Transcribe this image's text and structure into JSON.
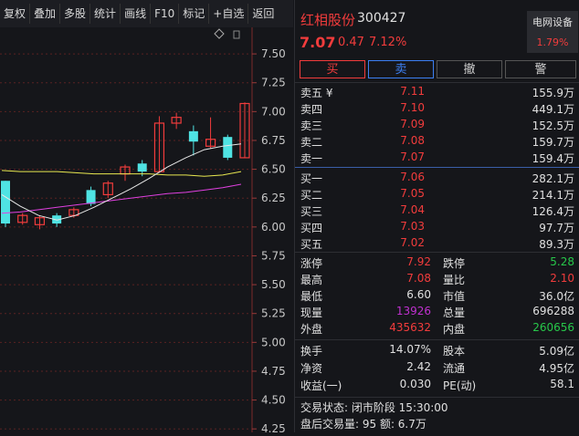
{
  "toolbar": [
    "复权",
    "叠加",
    "多股",
    "统计",
    "画线",
    "F10",
    "标记",
    "+自选",
    "返回"
  ],
  "stock": {
    "name": "红相股份",
    "code": "300427",
    "price": "7.07",
    "change": "0.47",
    "pct": "7.12%",
    "sector": "电网设备",
    "sector_pct": "1.79%"
  },
  "actions": [
    "买",
    "卖",
    "撤",
    "警"
  ],
  "asks": [
    {
      "label": "卖五 ¥",
      "price": "7.11",
      "vol": "155.9万"
    },
    {
      "label": "卖四",
      "price": "7.10",
      "vol": "449.1万"
    },
    {
      "label": "卖三",
      "price": "7.09",
      "vol": "152.5万"
    },
    {
      "label": "卖二",
      "price": "7.08",
      "vol": "159.7万"
    },
    {
      "label": "卖一",
      "price": "7.07",
      "vol": "159.4万"
    }
  ],
  "bids": [
    {
      "label": "买一",
      "price": "7.06",
      "vol": "282.1万"
    },
    {
      "label": "买二",
      "price": "7.05",
      "vol": "214.1万"
    },
    {
      "label": "买三",
      "price": "7.04",
      "vol": "126.4万"
    },
    {
      "label": "买四",
      "price": "7.03",
      "vol": "97.7万"
    },
    {
      "label": "买五",
      "price": "7.02",
      "vol": "89.3万"
    }
  ],
  "stats1": [
    {
      "l1": "涨停",
      "v1": "7.92",
      "c1": "red",
      "l2": "跌停",
      "v2": "5.28",
      "c2": "green"
    },
    {
      "l1": "最高",
      "v1": "7.08",
      "c1": "red",
      "l2": "量比",
      "v2": "2.10",
      "c2": "red"
    },
    {
      "l1": "最低",
      "v1": "6.60",
      "c1": "white",
      "l2": "市值",
      "v2": "36.0亿",
      "c2": "white"
    },
    {
      "l1": "现量",
      "v1": "13926",
      "c1": "purple",
      "l2": "总量",
      "v2": "696288",
      "c2": "white"
    },
    {
      "l1": "外盘",
      "v1": "435632",
      "c1": "red",
      "l2": "内盘",
      "v2": "260656",
      "c2": "green"
    }
  ],
  "stats2": [
    {
      "l1": "换手",
      "v1": "14.07%",
      "l2": "股本",
      "v2": "5.09亿"
    },
    {
      "l1": "净资",
      "v1": "2.42",
      "l2": "流通",
      "v2": "4.95亿"
    },
    {
      "l1": "收益(一)",
      "v1": "0.030",
      "l2": "PE(动)",
      "v2": "58.1"
    }
  ],
  "footer": {
    "status": "交易状态: 闭市阶段 15:30:00",
    "after": "盘后交易量: 95  额: 6.7万"
  },
  "chart_data": {
    "type": "candlestick",
    "y_ticks": [
      "7.50",
      "7.25",
      "7.00",
      "6.75",
      "6.50",
      "6.25",
      "6.00",
      "5.75",
      "5.50",
      "5.25",
      "5.00",
      "4.75",
      "4.50",
      "4.25"
    ],
    "ylim": [
      4.22,
      7.73
    ],
    "candles": [
      {
        "o": 6.4,
        "c": 6.03,
        "h": 6.4,
        "l": 6.0,
        "up": false
      },
      {
        "o": 6.04,
        "c": 6.1,
        "h": 6.12,
        "l": 6.02,
        "up": true
      },
      {
        "o": 6.02,
        "c": 6.08,
        "h": 6.1,
        "l": 5.98,
        "up": true
      },
      {
        "o": 6.1,
        "c": 6.03,
        "h": 6.12,
        "l": 6.0,
        "up": false
      },
      {
        "o": 6.1,
        "c": 6.15,
        "h": 6.17,
        "l": 6.08,
        "up": true
      },
      {
        "o": 6.32,
        "c": 6.2,
        "h": 6.35,
        "l": 6.18,
        "up": false
      },
      {
        "o": 6.28,
        "c": 6.38,
        "h": 6.4,
        "l": 6.25,
        "up": true
      },
      {
        "o": 6.46,
        "c": 6.52,
        "h": 6.54,
        "l": 6.4,
        "up": true
      },
      {
        "o": 6.55,
        "c": 6.48,
        "h": 6.58,
        "l": 6.44,
        "up": false
      },
      {
        "o": 6.48,
        "c": 6.9,
        "h": 6.96,
        "l": 6.47,
        "up": true
      },
      {
        "o": 6.9,
        "c": 6.95,
        "h": 6.99,
        "l": 6.85,
        "up": true
      },
      {
        "o": 6.83,
        "c": 6.74,
        "h": 6.88,
        "l": 6.62,
        "up": false
      },
      {
        "o": 6.76,
        "c": 6.7,
        "h": 6.95,
        "l": 6.68,
        "up": true
      },
      {
        "o": 6.78,
        "c": 6.6,
        "h": 6.8,
        "l": 6.58,
        "up": false
      },
      {
        "o": 6.6,
        "c": 7.07,
        "h": 7.08,
        "l": 6.6,
        "up": true
      }
    ],
    "ma_white": [
      6.28,
      6.18,
      6.1,
      6.06,
      6.1,
      6.17,
      6.25,
      6.33,
      6.42,
      6.52,
      6.6,
      6.67,
      6.7,
      6.72
    ],
    "ma_yellow": [
      6.49,
      6.48,
      6.48,
      6.48,
      6.47,
      6.46,
      6.46,
      6.46,
      6.46,
      6.45,
      6.45,
      6.44,
      6.45,
      6.48
    ],
    "ma_purple": [
      6.12,
      6.13,
      6.15,
      6.17,
      6.19,
      6.21,
      6.23,
      6.25,
      6.27,
      6.29,
      6.3,
      6.32,
      6.34,
      6.37
    ]
  }
}
